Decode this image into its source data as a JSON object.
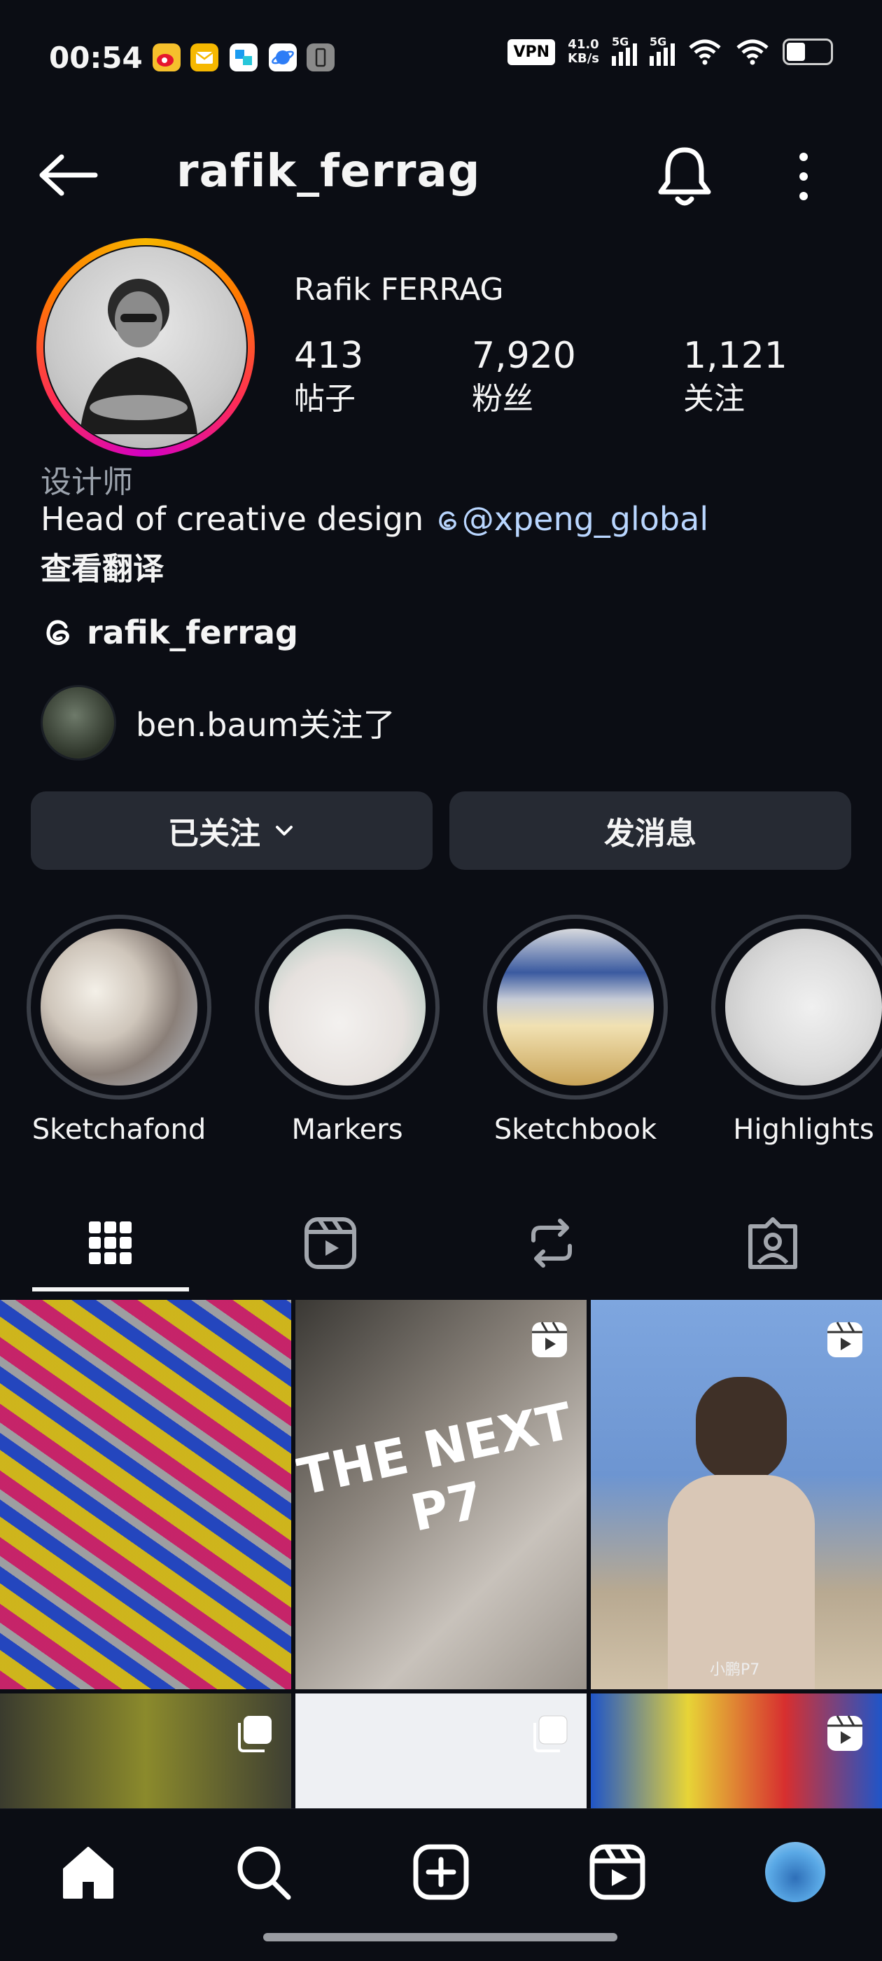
{
  "status_bar": {
    "time": "00:54",
    "vpn": "VPN",
    "net_speed_value": "41.0",
    "net_speed_unit": "KB/s",
    "sim1": "5G",
    "sim2": "5G",
    "notification_icons": [
      "weibo-icon",
      "mail-icon",
      "app-icon",
      "browser-icon",
      "phone-icon"
    ]
  },
  "header": {
    "username": "rafik_ferrag"
  },
  "profile": {
    "full_name": "Rafik FERRAG",
    "stats": [
      {
        "value": "413",
        "label": "帖子"
      },
      {
        "value": "7,920",
        "label": "粉丝"
      },
      {
        "value": "1,121",
        "label": "关注"
      }
    ],
    "category": "设计师",
    "bio_text": "Head of creative design ",
    "bio_mention": "@xpeng_global",
    "translate_label": "查看翻译",
    "threads_handle": "rafik_ferrag",
    "followed_by": "ben.baum关注了"
  },
  "actions": {
    "following_label": "已关注",
    "message_label": "发消息"
  },
  "highlights": [
    {
      "name": "Sketchafond"
    },
    {
      "name": "Markers"
    },
    {
      "name": "Sketchbook"
    },
    {
      "name": "Highlights"
    }
  ],
  "tabs": [
    "grid-icon",
    "reels-icon",
    "reposts-icon",
    "tagged-icon"
  ],
  "grid_posts": [
    {
      "type": "image"
    },
    {
      "type": "reel",
      "overlay_text": "THE NEXT P7"
    },
    {
      "type": "reel",
      "overlay_text": "小鹏P7"
    },
    {
      "type": "carousel"
    },
    {
      "type": "carousel"
    },
    {
      "type": "reel"
    }
  ],
  "bottom_nav": [
    "home-icon",
    "search-icon",
    "create-icon",
    "reels-icon",
    "profile-avatar"
  ],
  "colors": {
    "background": "#0b0d14",
    "button_bg": "#262a33",
    "mention": "#b9d6ff",
    "muted": "#9ca3ad"
  }
}
